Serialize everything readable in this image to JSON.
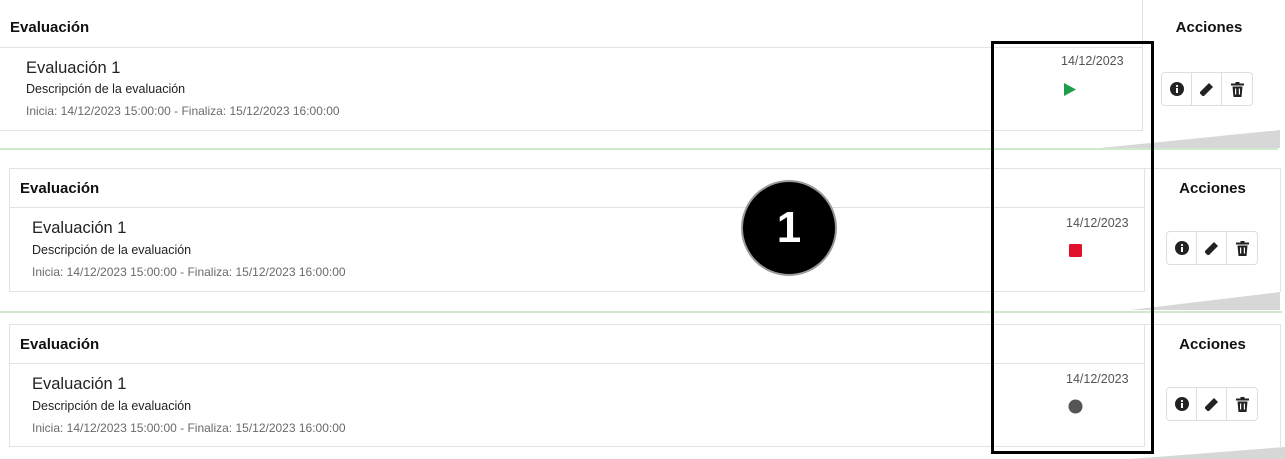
{
  "panels": [
    {
      "header": {
        "evaluation": "Evaluación",
        "actions": "Acciones"
      },
      "row": {
        "title": "Evaluación 1",
        "description": "Descripción de la evaluación",
        "schedule": "Inicia: 14/12/2023 15:00:00 - Finaliza: 15/12/2023 16:00:00",
        "date": "14/12/2023",
        "status_icon": "play-icon",
        "status_color": "#1e9e4a"
      },
      "buttons": [
        {
          "icon": "info-icon"
        },
        {
          "icon": "edit-pencil-icon"
        },
        {
          "icon": "trash-icon"
        }
      ]
    },
    {
      "header": {
        "evaluation": "Evaluación",
        "actions": "Acciones"
      },
      "row": {
        "title": "Evaluación 1",
        "description": "Descripción de la evaluación",
        "schedule": "Inicia: 14/12/2023 15:00:00 - Finaliza: 15/12/2023 16:00:00",
        "date": "14/12/2023",
        "status_icon": "stop-icon",
        "status_color": "#e0112b"
      },
      "buttons": [
        {
          "icon": "info-icon"
        },
        {
          "icon": "edit-pencil-icon"
        },
        {
          "icon": "trash-icon"
        }
      ]
    },
    {
      "header": {
        "evaluation": "Evaluación",
        "actions": "Acciones"
      },
      "row": {
        "title": "Evaluación 1",
        "description": "Descripción de la evaluación",
        "schedule": "Inicia: 14/12/2023 15:00:00 - Finaliza: 15/12/2023 16:00:00",
        "date": "14/12/2023",
        "status_icon": "dot-icon",
        "status_color": "#555555"
      },
      "buttons": [
        {
          "icon": "info-icon"
        },
        {
          "icon": "edit-pencil-icon"
        },
        {
          "icon": "trash-icon"
        }
      ]
    }
  ],
  "annotation": {
    "label": "1"
  }
}
